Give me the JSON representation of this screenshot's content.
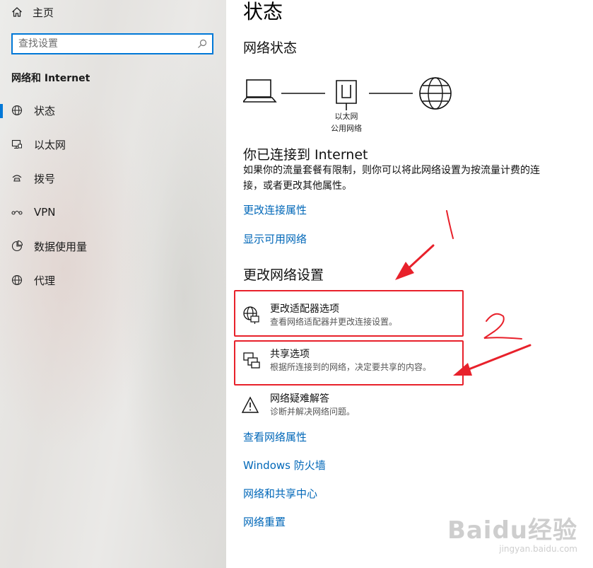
{
  "sidebar": {
    "home_label": "主页",
    "search_placeholder": "查找设置",
    "section_title": "网络和 Internet",
    "items": [
      {
        "label": "状态",
        "icon": "globe-icon"
      },
      {
        "label": "以太网",
        "icon": "ethernet-icon"
      },
      {
        "label": "拨号",
        "icon": "dialup-icon"
      },
      {
        "label": "VPN",
        "icon": "vpn-icon"
      },
      {
        "label": "数据使用量",
        "icon": "data-usage-icon"
      },
      {
        "label": "代理",
        "icon": "globe-icon"
      }
    ]
  },
  "main": {
    "title": "状态",
    "network_status_heading": "网络状态",
    "diagram": {
      "caption_line1": "以太网",
      "caption_line2": "公用网络"
    },
    "connected_heading": "你已连接到 Internet",
    "connected_desc": "如果你的流量套餐有限制，则你可以将此网络设置为按流量计费的连接，或者更改其他属性。",
    "links_top": [
      "更改连接属性",
      "显示可用网络"
    ],
    "change_heading": "更改网络设置",
    "options": [
      {
        "title": "更改适配器选项",
        "desc": "查看网络适配器并更改连接设置。",
        "icon": "adapter-icon"
      },
      {
        "title": "共享选项",
        "desc": "根据所连接到的网络，决定要共享的内容。",
        "icon": "sharing-icon"
      },
      {
        "title": "网络疑难解答",
        "desc": "诊断并解决网络问题。",
        "icon": "warning-icon"
      }
    ],
    "links_bottom": [
      "查看网络属性",
      "Windows 防火墙",
      "网络和共享中心",
      "网络重置"
    ]
  },
  "colors": {
    "accent": "#0078d7",
    "link": "#0067b8",
    "annotation": "#e8212b"
  },
  "watermark": {
    "line1": "Baidu经验",
    "line2": "jingyan.baidu.com"
  }
}
